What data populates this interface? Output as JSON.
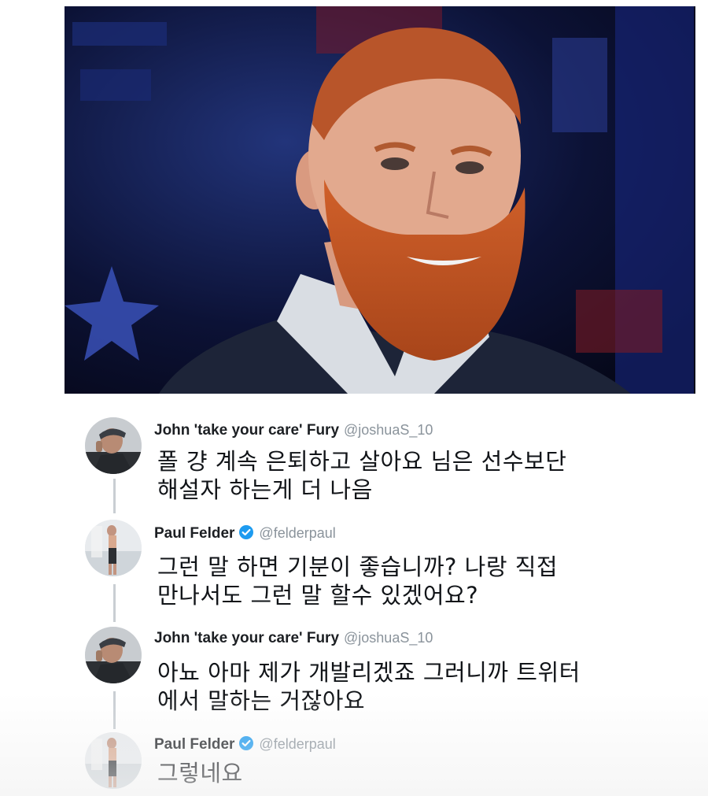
{
  "photo": {
    "icon": "fighter-portrait-photo",
    "colors": {
      "background": "#0b1030",
      "beard": "#c4521f",
      "skin": "#e2a98e"
    }
  },
  "thread": {
    "tweets": [
      {
        "display_name": "John 'take your care' Fury",
        "handle": "@joshuaS_10",
        "verified": false,
        "lines": [
          "폴 걍 계속 은퇴하고 살아요 님은 선수보단",
          "해설자 하는게 더 나음"
        ]
      },
      {
        "display_name": "Paul Felder",
        "handle": "@felderpaul",
        "verified": true,
        "lines": [
          "그런 말 하면 기분이 좋습니까? 나랑 직접",
          "만나서도 그런 말 할수 있겠어요?"
        ]
      },
      {
        "display_name": "John 'take your care' Fury",
        "handle": "@joshuaS_10",
        "verified": false,
        "lines": [
          "아뇨 아마 제가 개발리겠죠 그러니까 트위터",
          "에서 말하는 거잖아요"
        ]
      },
      {
        "display_name": "Paul Felder",
        "handle": "@felderpaul",
        "verified": true,
        "lines": [
          "그렇네요"
        ]
      }
    ]
  },
  "colors": {
    "name": "#1c1f23",
    "handle": "#8a939b",
    "text": "#111418",
    "verified": "#1d9bf0",
    "thread_line": "#c9ced3"
  }
}
